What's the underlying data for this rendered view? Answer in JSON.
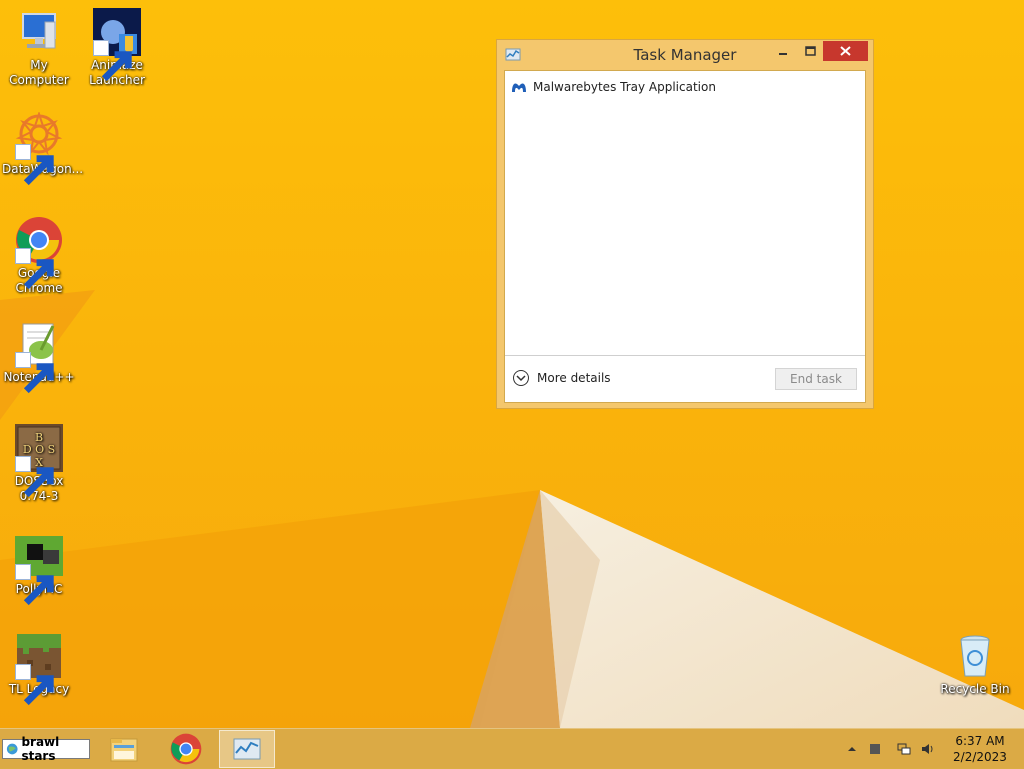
{
  "desktop": {
    "icons": [
      {
        "label": "My Computer",
        "icon": "computer-icon"
      },
      {
        "label": "Animaze Launcher",
        "icon": "animaze-icon"
      },
      {
        "label": "DataWagon...",
        "icon": "datawagon-icon"
      },
      {
        "label": "Google Chrome",
        "icon": "chrome-icon"
      },
      {
        "label": "Notepad++",
        "icon": "notepadpp-icon"
      },
      {
        "label": "DOSBox 0.74-3",
        "icon": "dosbox-icon"
      },
      {
        "label": "PollyMC",
        "icon": "pollymc-icon"
      },
      {
        "label": "TL Legacy",
        "icon": "grass-block-icon"
      },
      {
        "label": "Recycle Bin",
        "icon": "recycle-bin-icon"
      }
    ]
  },
  "task_manager": {
    "title": "Task Manager",
    "processes": [
      {
        "name": "Malwarebytes Tray Application",
        "icon": "malwarebytes-icon"
      }
    ],
    "more_details_label": "More details",
    "end_task_label": "End task",
    "close_color": "#c7372d"
  },
  "taskbar": {
    "search_text": "brawl stars",
    "pinned": [
      {
        "name": "File Explorer",
        "icon": "folder-icon"
      },
      {
        "name": "Google Chrome",
        "icon": "chrome-icon"
      },
      {
        "name": "Task Manager",
        "icon": "task-manager-icon",
        "active": true
      }
    ],
    "tray_icons": [
      "chevron-up-icon",
      "action-center-icon",
      "network-icon",
      "volume-icon"
    ],
    "time": "6:37 AM",
    "date": "2/2/2023"
  }
}
